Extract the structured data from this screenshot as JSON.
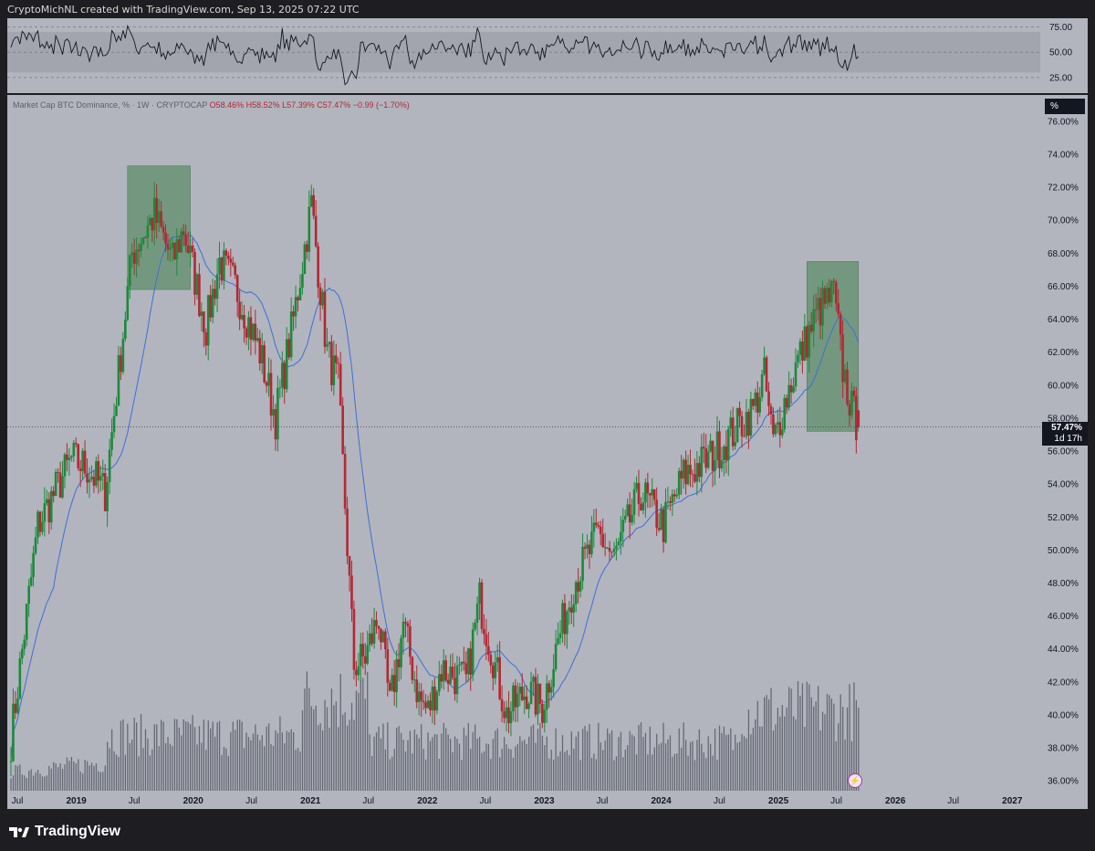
{
  "header": {
    "attribution": "CryptoMichNL created with TradingView.com, Sep 13, 2025 07:22 UTC"
  },
  "rsi": {
    "ticks": [
      "75.00",
      "50.00",
      "25.00"
    ],
    "tick_values": [
      75,
      50,
      25
    ],
    "band": [
      30,
      70
    ],
    "line_color": "#131722",
    "band_color": "#9ea1aa"
  },
  "legend": {
    "symbol": "Market Cap BTC Dominance, % · 1W · CRYPTOCAP",
    "open": "O58.46%",
    "high": "H58.52%",
    "low": "L57.39%",
    "close": "C57.47%",
    "change": "−0.99 (−1.70%)"
  },
  "price_axis": {
    "unit_label": "%",
    "ticks": [
      "76.00%",
      "74.00%",
      "72.00%",
      "70.00%",
      "68.00%",
      "66.00%",
      "64.00%",
      "62.00%",
      "60.00%",
      "58.00%",
      "56.00%",
      "54.00%",
      "52.00%",
      "50.00%",
      "48.00%",
      "46.00%",
      "44.00%",
      "42.00%",
      "40.00%",
      "38.00%",
      "36.00%"
    ],
    "last_price": "57.47%",
    "countdown": "1d 17h"
  },
  "time_axis": {
    "labels": [
      "Jul",
      "2019",
      "Jul",
      "2020",
      "Jul",
      "2021",
      "Jul",
      "2022",
      "Jul",
      "2023",
      "Jul",
      "2024",
      "Jul",
      "2025",
      "Jul",
      "2026",
      "Jul",
      "2027"
    ],
    "bold": [
      false,
      true,
      false,
      true,
      false,
      true,
      false,
      true,
      false,
      true,
      false,
      true,
      false,
      true,
      false,
      true,
      false,
      true
    ],
    "dates": [
      "2018-07-01",
      "2019-01-01",
      "2019-07-01",
      "2020-01-01",
      "2020-07-01",
      "2021-01-01",
      "2021-07-01",
      "2022-01-01",
      "2022-07-01",
      "2023-01-01",
      "2023-07-01",
      "2024-01-01",
      "2024-07-01",
      "2025-01-01",
      "2025-07-01",
      "2026-01-01",
      "2026-07-01",
      "2027-01-01"
    ]
  },
  "colors": {
    "up": "#1b8a3a",
    "down": "#b22833",
    "ma": "#3d6fd6",
    "volume": "#5d606b",
    "highlight": "#5f8f6a",
    "background": "#b2b5be"
  },
  "chart_data": {
    "type": "candlestick",
    "series": [
      {
        "name": "Market Cap BTC Dominance, %",
        "interval": "1W",
        "anchors": [
          {
            "date": "2018-06-11",
            "value": 38.5
          },
          {
            "date": "2018-09-03",
            "value": 51.5
          },
          {
            "date": "2018-12-17",
            "value": 55.5
          },
          {
            "date": "2019-02-04",
            "value": 55.0
          },
          {
            "date": "2019-04-01",
            "value": 53.5
          },
          {
            "date": "2019-06-24",
            "value": 68.0
          },
          {
            "date": "2019-09-02",
            "value": 70.3
          },
          {
            "date": "2019-10-28",
            "value": 67.5
          },
          {
            "date": "2019-12-02",
            "value": 69.5
          },
          {
            "date": "2020-02-10",
            "value": 63.5
          },
          {
            "date": "2020-03-23",
            "value": 67.5
          },
          {
            "date": "2020-05-11",
            "value": 66.0
          },
          {
            "date": "2020-07-27",
            "value": 62.0
          },
          {
            "date": "2020-09-14",
            "value": 58.0
          },
          {
            "date": "2020-11-09",
            "value": 64.0
          },
          {
            "date": "2021-01-04",
            "value": 71.0
          },
          {
            "date": "2021-02-22",
            "value": 62.0
          },
          {
            "date": "2021-03-29",
            "value": 60.0
          },
          {
            "date": "2021-05-17",
            "value": 43.0
          },
          {
            "date": "2021-06-21",
            "value": 43.5
          },
          {
            "date": "2021-08-02",
            "value": 46.0
          },
          {
            "date": "2021-09-06",
            "value": 40.5
          },
          {
            "date": "2021-10-18",
            "value": 45.5
          },
          {
            "date": "2021-12-06",
            "value": 41.0
          },
          {
            "date": "2022-01-03",
            "value": 40.2
          },
          {
            "date": "2022-02-14",
            "value": 42.8
          },
          {
            "date": "2022-05-02",
            "value": 42.0
          },
          {
            "date": "2022-06-13",
            "value": 47.0
          },
          {
            "date": "2022-09-05",
            "value": 40.0
          },
          {
            "date": "2022-11-07",
            "value": 41.5
          },
          {
            "date": "2022-12-26",
            "value": 40.5
          },
          {
            "date": "2023-02-13",
            "value": 44.5
          },
          {
            "date": "2023-04-03",
            "value": 48.0
          },
          {
            "date": "2023-06-19",
            "value": 51.0
          },
          {
            "date": "2023-08-07",
            "value": 49.5
          },
          {
            "date": "2023-10-30",
            "value": 53.5
          },
          {
            "date": "2024-01-08",
            "value": 51.5
          },
          {
            "date": "2024-03-11",
            "value": 54.5
          },
          {
            "date": "2024-05-27",
            "value": 55.5
          },
          {
            "date": "2024-08-05",
            "value": 57.0
          },
          {
            "date": "2024-10-14",
            "value": 58.5
          },
          {
            "date": "2024-11-18",
            "value": 60.5
          },
          {
            "date": "2024-12-16",
            "value": 56.5
          },
          {
            "date": "2025-01-13",
            "value": 58.5
          },
          {
            "date": "2025-03-03",
            "value": 61.5
          },
          {
            "date": "2025-05-05",
            "value": 64.5
          },
          {
            "date": "2025-06-23",
            "value": 65.5
          },
          {
            "date": "2025-07-21",
            "value": 61.0
          },
          {
            "date": "2025-08-18",
            "value": 58.5
          },
          {
            "date": "2025-09-08",
            "value": 57.47
          }
        ]
      },
      {
        "name": "Moving Average",
        "type": "line",
        "period": 20
      },
      {
        "name": "Volume",
        "type": "bar"
      },
      {
        "name": "RSI",
        "type": "line",
        "pane": "top",
        "ylim": [
          0,
          100
        ]
      }
    ],
    "highlights": [
      {
        "from": "2019-06-10",
        "to": "2019-12-23",
        "ylim": [
          65.8,
          73.3
        ]
      },
      {
        "from": "2025-03-31",
        "to": "2025-09-08",
        "ylim": [
          57.2,
          67.5
        ]
      }
    ],
    "xlim": [
      "2018-06-11",
      "2027-03-01"
    ],
    "ylim": [
      35.4,
      77.6
    ],
    "last_value": 57.47,
    "open": 58.46,
    "high": 58.52,
    "low": 57.39,
    "close": 57.47
  }
}
